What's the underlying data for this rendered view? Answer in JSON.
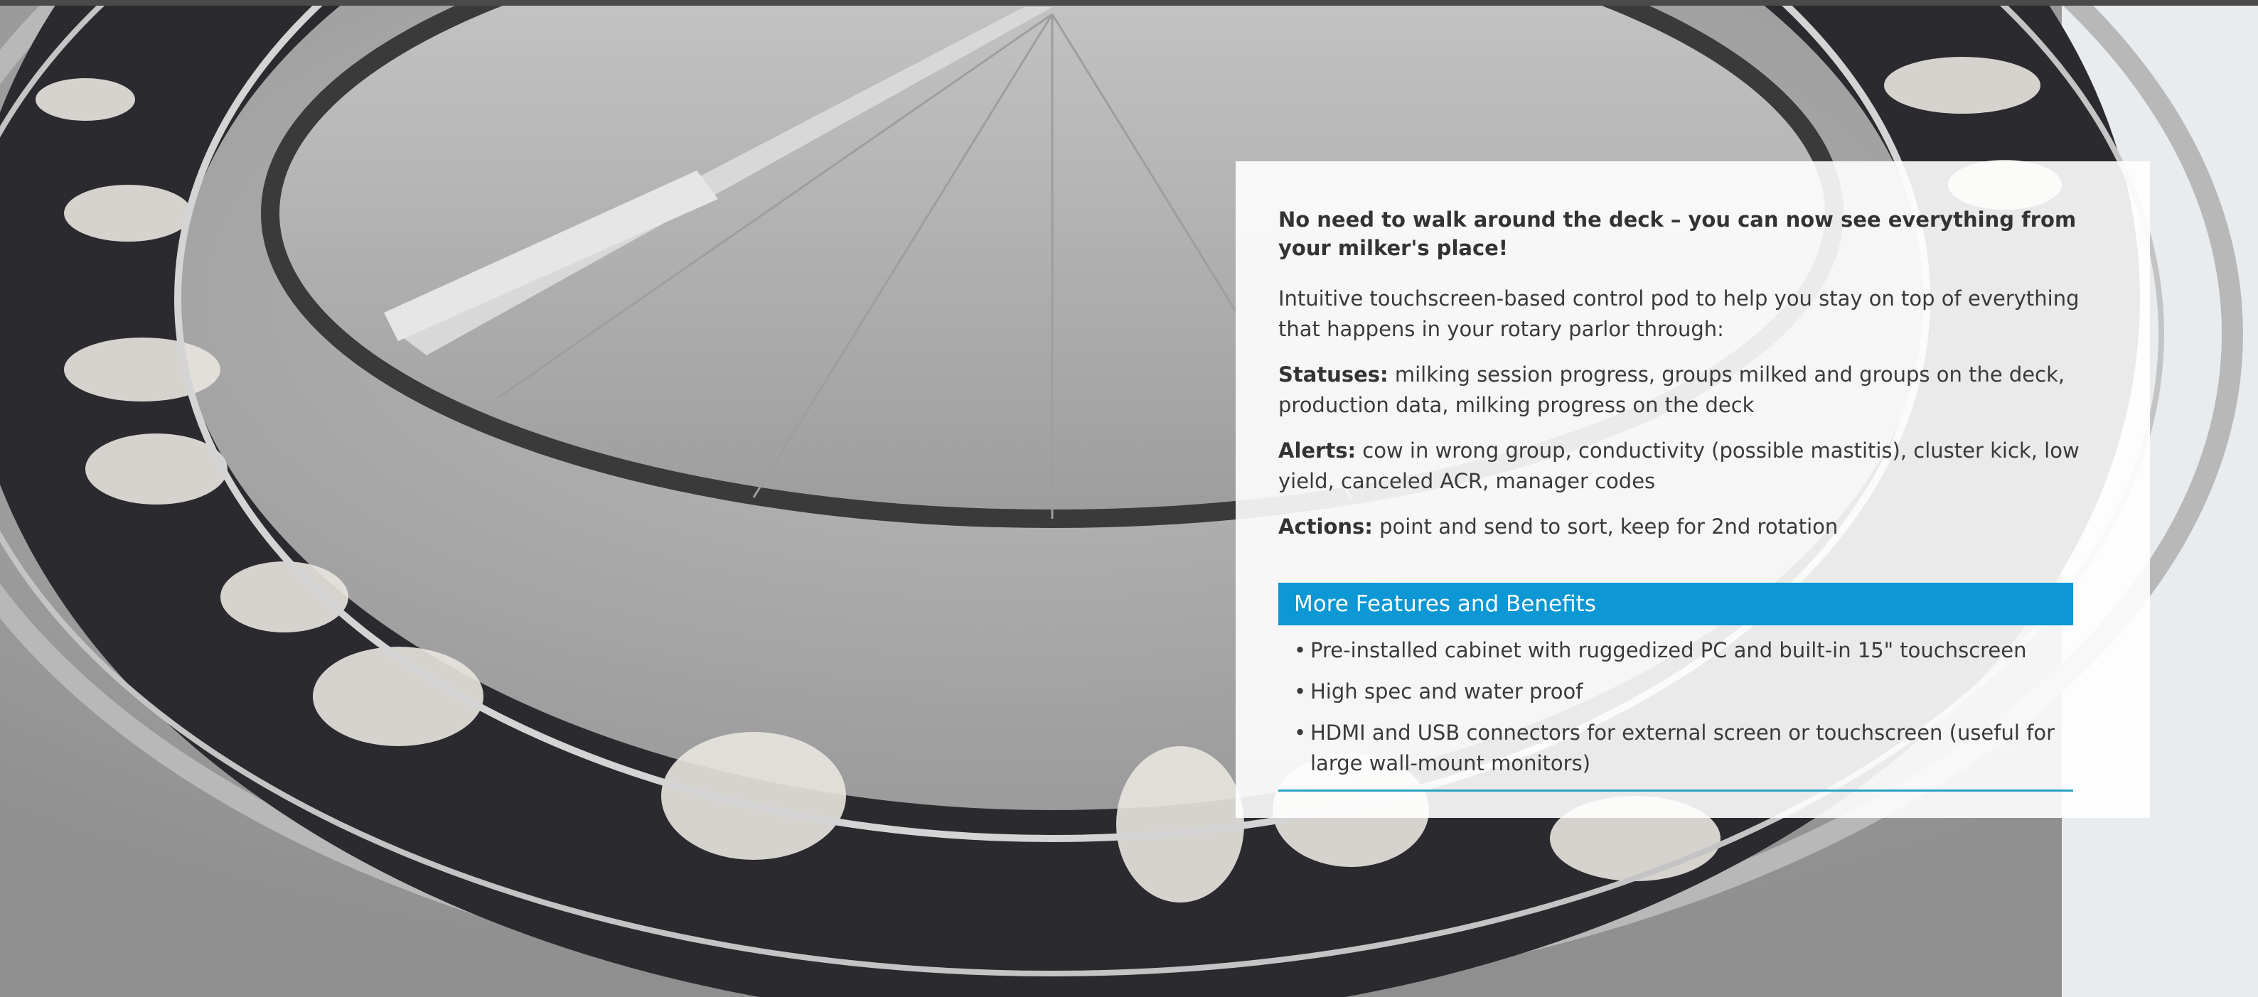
{
  "headline": "No need to walk around the deck – you can now see everything from your milker's place!",
  "intro": "Intuitive touchscreen-based control pod to help you stay on top of everything that happens in your rotary parlor through:",
  "statuses": {
    "label": "Statuses:",
    "text": " milking session progress, groups milked and groups on the deck, production data, milking progress on the deck"
  },
  "alerts": {
    "label": "Alerts:",
    "text": " cow in wrong group, conductivity (possible mastitis), cluster kick, low yield, canceled ACR, manager codes"
  },
  "actions": {
    "label": "Actions:",
    "text": " point and send to sort, keep for 2nd rotation"
  },
  "section": {
    "title": "More Features and Benefits"
  },
  "features": [
    "Pre-installed cabinet with ruggedized PC and built-in 15\" touchscreen",
    "High spec and water proof",
    "HDMI and USB connectors for external screen or touchscreen (useful for large wall-mount monitors)"
  ],
  "bullet_char": "•",
  "colors": {
    "accent": "#0d97d4",
    "rule": "#2aa3c4",
    "text": "#3a3a3a"
  }
}
